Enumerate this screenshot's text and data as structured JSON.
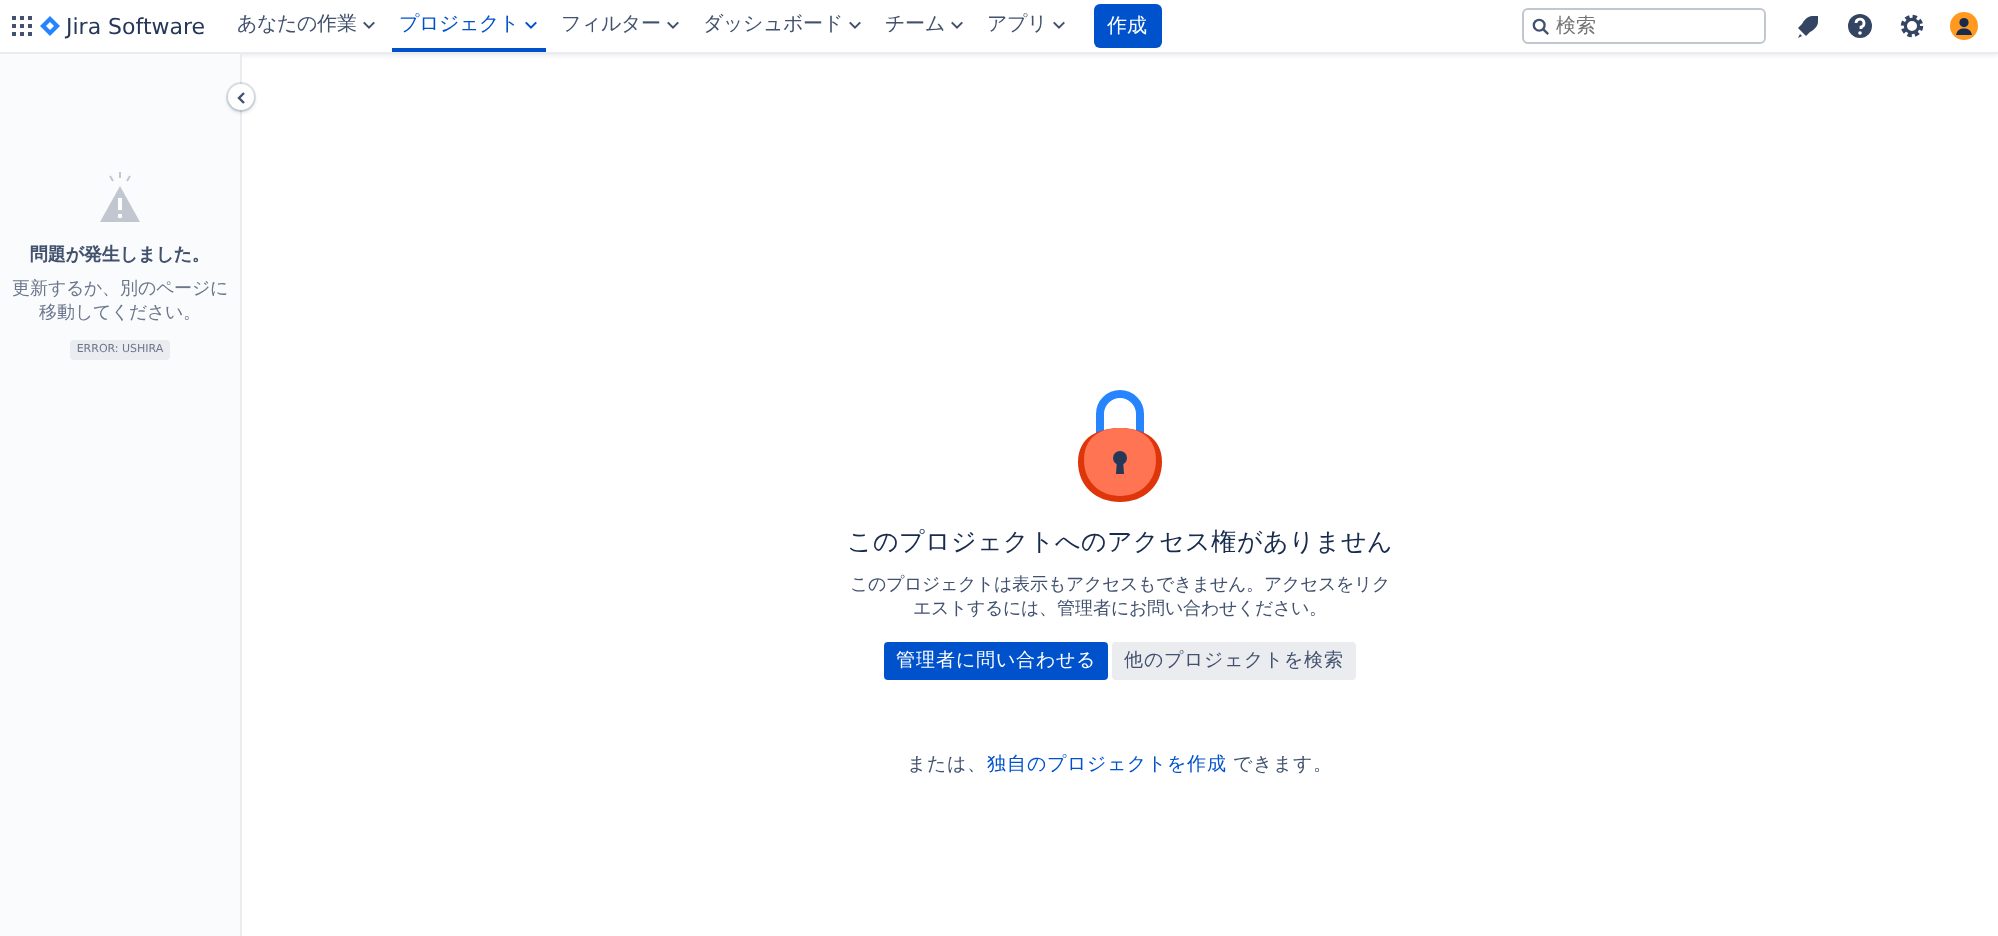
{
  "topbar": {
    "product": "Jira Software",
    "nav_items": [
      {
        "label": "あなたの作業",
        "selected": false
      },
      {
        "label": "プロジェクト",
        "selected": true
      },
      {
        "label": "フィルター",
        "selected": false
      },
      {
        "label": "ダッシュボード",
        "selected": false
      },
      {
        "label": "チーム",
        "selected": false
      },
      {
        "label": "アプリ",
        "selected": false
      }
    ],
    "create_button": "作成",
    "search": {
      "placeholder": "検索"
    }
  },
  "sidebar": {
    "error_title": "問題が発生しました。",
    "error_message": "更新するか、別のページに移動してください。",
    "error_code": "ERROR: USHIRA"
  },
  "main": {
    "title": "このプロジェクトへのアクセス権がありません",
    "message": "このプロジェクトは表示もアクセスもできません。アクセスをリクエストするには、管理者にお問い合わせください。",
    "primary_button": "管理者に問い合わせる",
    "secondary_button": "他のプロジェクトを検索",
    "footer": {
      "before": "または、",
      "link": "独自のプロジェクトを作成",
      "after": " できます。"
    }
  }
}
